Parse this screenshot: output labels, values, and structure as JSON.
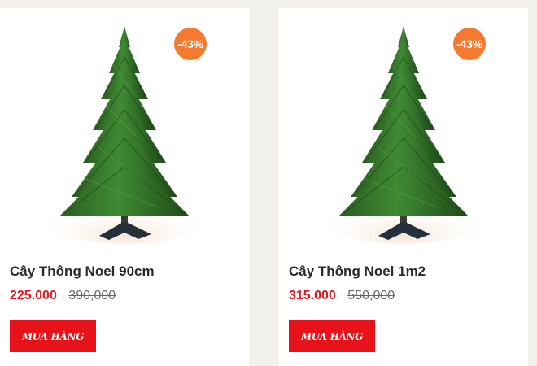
{
  "products": [
    {
      "title": "Cây Thông Noel 90cm",
      "discount": "-43%",
      "price_new": "225.000",
      "price_old": "390,000",
      "button": "MUA HÀNG"
    },
    {
      "title": "Cây Thông Noel 1m2",
      "discount": "-43%",
      "price_new": "315.000",
      "price_old": "550,000",
      "button": "MUA HÀNG"
    }
  ],
  "colors": {
    "badge": "#f5792e",
    "price": "#e0161b",
    "button": "#e8131a",
    "tree": "#2f6b2a"
  },
  "icons": [
    "christmas-tree-image"
  ]
}
